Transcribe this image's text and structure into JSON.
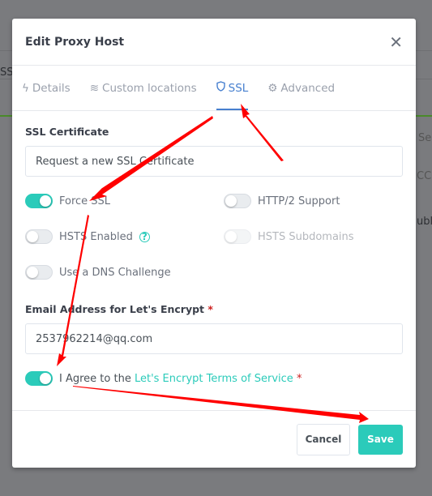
{
  "background": {
    "fragments": [
      "SSL",
      "Sea",
      "CCES",
      "ubli"
    ]
  },
  "modal": {
    "title": "Edit Proxy Host",
    "tabs": [
      {
        "label": "Details",
        "icon": "zap-icon"
      },
      {
        "label": "Custom locations",
        "icon": "layers-icon"
      },
      {
        "label": "SSL",
        "icon": "shield-icon",
        "active": true
      },
      {
        "label": "Advanced",
        "icon": "gear-icon"
      }
    ],
    "ssl_certificate_label": "SSL Certificate",
    "ssl_certificate_value": "Request a new SSL Certificate",
    "toggles": [
      {
        "label": "Force SSL",
        "on": true
      },
      {
        "label": "HTTP/2 Support",
        "on": false
      },
      {
        "label": "HSTS Enabled",
        "on": false
      },
      {
        "label": "HSTS Subdomains",
        "on": false,
        "disabled": true
      },
      {
        "label": "Use a DNS Challenge",
        "on": false
      }
    ],
    "email_label": "Email Address for Let's Encrypt",
    "required_mark": "*",
    "email_value": "2537962214@qq.com",
    "agree_prefix": "I Agree to the ",
    "agree_link": "Let's Encrypt Terms of Service",
    "agree_on": true,
    "cancel": "Cancel",
    "save": "Save"
  },
  "colors": {
    "accent": "#2bcbba",
    "tab_active": "#467fcf",
    "annotation": "#ff0000"
  }
}
